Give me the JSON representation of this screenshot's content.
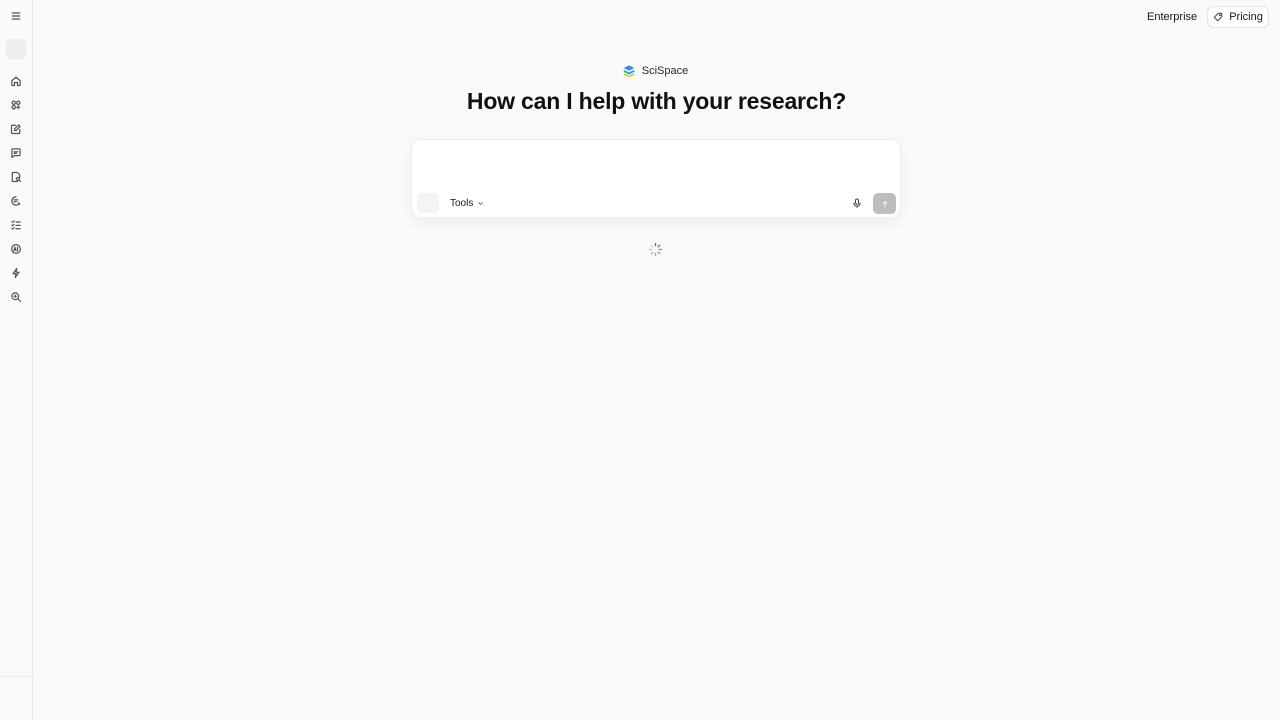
{
  "sidebar": {
    "items": [
      {
        "icon": "menu-icon"
      },
      {
        "icon": "home-icon"
      },
      {
        "icon": "agents-icon"
      },
      {
        "icon": "write-icon"
      },
      {
        "icon": "chat-icon"
      },
      {
        "icon": "literature-review-icon"
      },
      {
        "icon": "paraphrase-icon"
      },
      {
        "icon": "extract-data-icon"
      },
      {
        "icon": "ai-detector-icon"
      },
      {
        "icon": "flash-icon"
      },
      {
        "icon": "search-icon"
      }
    ]
  },
  "topbar": {
    "enterprise_label": "Enterprise",
    "pricing_label": "Pricing"
  },
  "brand": {
    "name": "SciSpace"
  },
  "main": {
    "headline": "How can I help with your research?"
  },
  "composer": {
    "placeholder": "",
    "value": "",
    "tools_label": "Tools",
    "send_disabled": true
  },
  "colors": {
    "background": "#fafafa",
    "send_button": "#bdbdbd",
    "text": "#18181b"
  }
}
